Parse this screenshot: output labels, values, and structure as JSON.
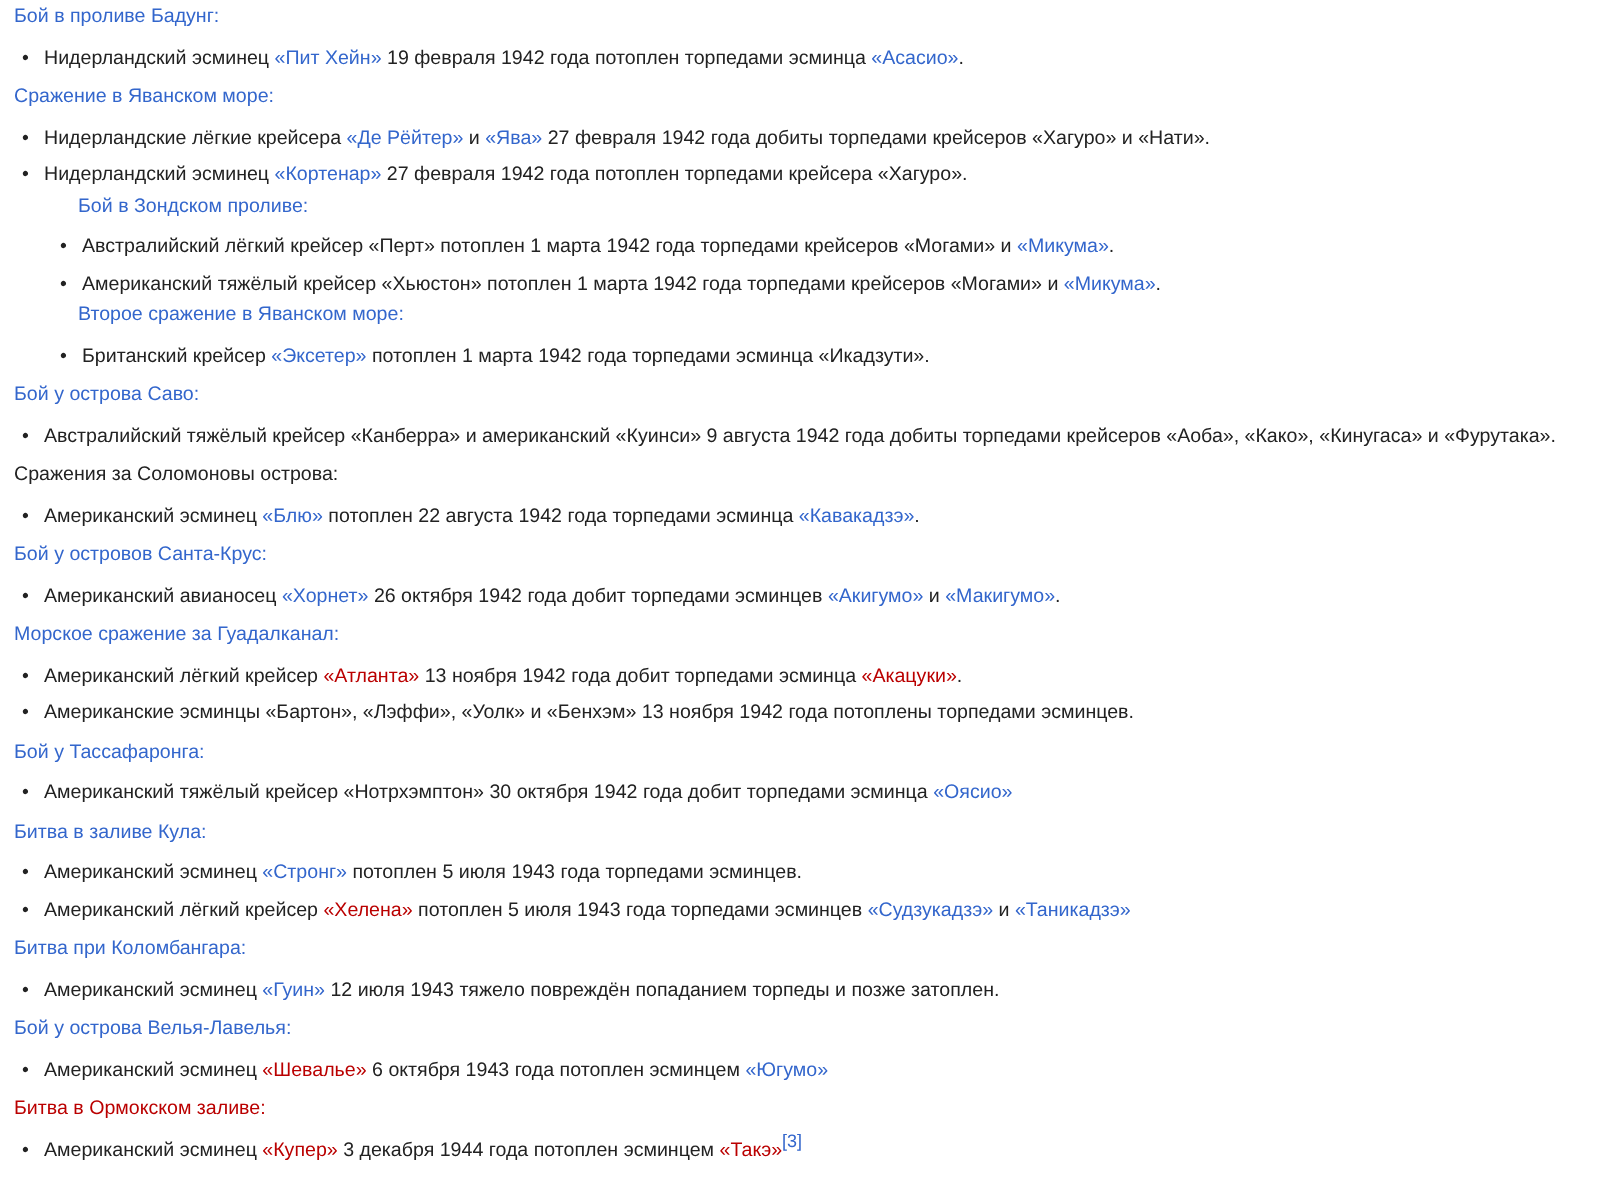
{
  "bullet": "•",
  "sections": [
    {
      "heading": {
        "text": "Бой в проливе Бадунг:",
        "kind": "link"
      },
      "items": [
        [
          {
            "text": "Нидерландский эсминец ",
            "kind": "text"
          },
          {
            "text": "«Пит Хейн»",
            "kind": "link"
          },
          {
            "text": " 19 февраля 1942 года потоплен торпедами эсминца ",
            "kind": "text"
          },
          {
            "text": "«Асасио»",
            "kind": "link"
          },
          {
            "text": ".",
            "kind": "text"
          }
        ]
      ]
    },
    {
      "heading": {
        "text": "Сражение в Яванском море:",
        "kind": "link"
      },
      "items": [
        [
          {
            "text": "Нидерландские лёгкие крейсера ",
            "kind": "text"
          },
          {
            "text": "«Де Рёйтер»",
            "kind": "link"
          },
          {
            "text": " и ",
            "kind": "text"
          },
          {
            "text": "«Ява»",
            "kind": "link"
          },
          {
            "text": " 27 февраля 1942 года добиты торпедами крейсеров «Хагуро» и «Нати».",
            "kind": "text"
          }
        ],
        [
          {
            "text": "Нидерландский эсминец ",
            "kind": "text"
          },
          {
            "text": "«Кортенар»",
            "kind": "link"
          },
          {
            "text": " 27 февраля 1942 года потоплен торпедами крейсера «Хагуро».",
            "kind": "text"
          }
        ]
      ],
      "subsections": [
        {
          "heading": {
            "text": "Бой в Зондском проливе:",
            "kind": "link"
          },
          "items": [
            [
              {
                "text": "Австралийский лёгкий крейсер «Перт» потоплен 1 марта 1942 года торпедами крейсеров «Могами» и ",
                "kind": "text"
              },
              {
                "text": "«Микума»",
                "kind": "link"
              },
              {
                "text": ".",
                "kind": "text"
              }
            ],
            [
              {
                "text": "Американский тяжёлый крейсер «Хьюстон» потоплен 1 марта 1942 года торпедами крейсеров «Могами» и ",
                "kind": "text"
              },
              {
                "text": "«Микума»",
                "kind": "link"
              },
              {
                "text": ".",
                "kind": "text"
              }
            ]
          ]
        },
        {
          "heading": {
            "text": "Второе сражение в Яванском море:",
            "kind": "link"
          },
          "items": [
            [
              {
                "text": "Британский крейсер ",
                "kind": "text"
              },
              {
                "text": "«Эксетер»",
                "kind": "link"
              },
              {
                "text": " потоплен 1 марта 1942 года торпедами эсминца «Икадзути».",
                "kind": "text"
              }
            ]
          ]
        }
      ]
    },
    {
      "heading": {
        "text": "Бой у острова Саво:",
        "kind": "link"
      },
      "items": [
        [
          {
            "text": "Австралийский тяжёлый крейсер «Канберра» и американский «Куинси» 9 августа 1942 года добиты торпедами крейсеров «Аоба», «Како», «Кинугаса» и «Фурутака».",
            "kind": "text"
          }
        ]
      ]
    },
    {
      "heading": {
        "text": "Сражения за Соломоновы острова:",
        "kind": "text"
      },
      "items": [
        [
          {
            "text": "Американский эсминец ",
            "kind": "text"
          },
          {
            "text": "«Блю»",
            "kind": "link"
          },
          {
            "text": " потоплен 22 августа 1942 года торпедами эсминца ",
            "kind": "text"
          },
          {
            "text": "«Кавакадзэ»",
            "kind": "link"
          },
          {
            "text": ".",
            "kind": "text"
          }
        ]
      ]
    },
    {
      "heading": {
        "text": "Бой у островов Санта-Крус:",
        "kind": "link"
      },
      "items": [
        [
          {
            "text": "Американский авианосец ",
            "kind": "text"
          },
          {
            "text": "«Хорнет»",
            "kind": "link"
          },
          {
            "text": " 26 октября 1942 года добит торпедами эсминцев ",
            "kind": "text"
          },
          {
            "text": "«Акигумо»",
            "kind": "link"
          },
          {
            "text": " и ",
            "kind": "text"
          },
          {
            "text": "«Макигумо»",
            "kind": "link"
          },
          {
            "text": ".",
            "kind": "text"
          }
        ]
      ]
    },
    {
      "heading": {
        "text": "Морское сражение за Гуадалканал:",
        "kind": "link"
      },
      "items": [
        [
          {
            "text": "Американский лёгкий крейсер ",
            "kind": "text"
          },
          {
            "text": "«Атланта»",
            "kind": "redlink"
          },
          {
            "text": " 13 ноября 1942 года добит торпедами эсминца ",
            "kind": "text"
          },
          {
            "text": "«Акацуки»",
            "kind": "redlink"
          },
          {
            "text": ".",
            "kind": "text"
          }
        ],
        [
          {
            "text": "Американские эсминцы «Бартон», «Лэффи», «Уолк» и «Бенхэм» 13 ноября 1942 года потоплены торпедами эсминцев.",
            "kind": "text"
          }
        ]
      ]
    },
    {
      "heading": {
        "text": "Бой у Тассафаронга:",
        "kind": "link"
      },
      "items": [
        [
          {
            "text": "Американский тяжёлый крейсер «Нотрхэмптон» 30 октября 1942 года добит торпедами эсминца ",
            "kind": "text"
          },
          {
            "text": "«Оясио»",
            "kind": "link"
          }
        ]
      ]
    },
    {
      "heading": {
        "text": "Битва в заливе Кула:",
        "kind": "link"
      },
      "items": [
        [
          {
            "text": "Американский эсминец ",
            "kind": "text"
          },
          {
            "text": "«Стронг»",
            "kind": "link"
          },
          {
            "text": " потоплен 5 июля 1943 года торпедами эсминцев.",
            "kind": "text"
          }
        ],
        [
          {
            "text": "Американский лёгкий крейсер ",
            "kind": "text"
          },
          {
            "text": "«Хелена»",
            "kind": "redlink"
          },
          {
            "text": " потоплен 5 июля 1943 года торпедами эсминцев ",
            "kind": "text"
          },
          {
            "text": "«Судзукадзэ»",
            "kind": "link"
          },
          {
            "text": " и ",
            "kind": "text"
          },
          {
            "text": "«Таникадзэ»",
            "kind": "link"
          }
        ]
      ]
    },
    {
      "heading": {
        "text": "Битва при Коломбангара:",
        "kind": "link"
      },
      "items": [
        [
          {
            "text": "Американский эсминец ",
            "kind": "text"
          },
          {
            "text": "«Гуин»",
            "kind": "link"
          },
          {
            "text": " 12 июля 1943 тяжело повреждён попаданием торпеды и позже затоплен.",
            "kind": "text"
          }
        ]
      ]
    },
    {
      "heading": {
        "text": "Бой у острова Велья-Лавелья:",
        "kind": "link"
      },
      "items": [
        [
          {
            "text": "Американский эсминец ",
            "kind": "text"
          },
          {
            "text": "«Шевалье»",
            "kind": "redlink"
          },
          {
            "text": " 6 октября 1943 года потоплен эсминцем ",
            "kind": "text"
          },
          {
            "text": "«Югумо»",
            "kind": "link"
          }
        ]
      ]
    },
    {
      "heading": {
        "text": "Битва в Ормокском заливе:",
        "kind": "redlink"
      },
      "items": [
        [
          {
            "text": "Американский эсминец ",
            "kind": "text"
          },
          {
            "text": "«Купер»",
            "kind": "redlink"
          },
          {
            "text": " 3 декабря 1944 года потоплен эсминцем ",
            "kind": "text"
          },
          {
            "text": "«Такэ»",
            "kind": "redlink"
          },
          {
            "text": "[3]",
            "kind": "ref"
          }
        ]
      ]
    }
  ]
}
